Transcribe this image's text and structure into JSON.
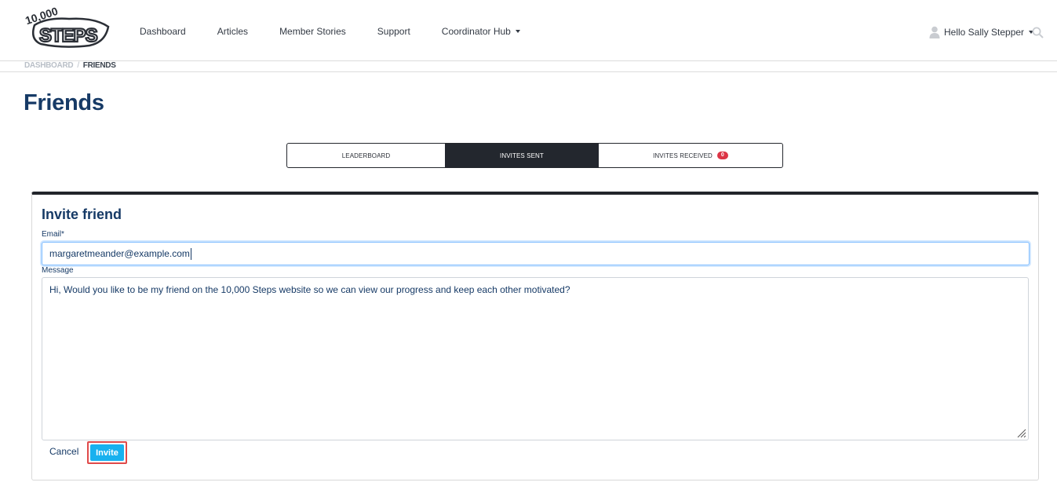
{
  "header": {
    "logo_text": "10,000 STEPS",
    "nav": [
      {
        "label": "Dashboard"
      },
      {
        "label": "Articles"
      },
      {
        "label": "Member Stories"
      },
      {
        "label": "Support"
      },
      {
        "label": "Coordinator Hub",
        "dropdown": true
      }
    ],
    "user_greeting": "Hello Sally Stepper"
  },
  "breadcrumb": {
    "items": [
      "DASHBOARD",
      "FRIENDS"
    ],
    "separator": "/"
  },
  "page": {
    "title": "Friends"
  },
  "tabs": [
    {
      "label": "LEADERBOARD",
      "active": false
    },
    {
      "label": "INVITES SENT",
      "active": true
    },
    {
      "label": "INVITES RECEIVED",
      "active": false,
      "badge": "0"
    }
  ],
  "invite_form": {
    "title": "Invite friend",
    "email_label": "Email*",
    "email_value": "margaretmeander@example.com",
    "message_label": "Message",
    "message_value": "Hi, Would you like to be my friend on the 10,000 Steps website so we can view our progress and keep each other motivated?",
    "cancel_label": "Cancel",
    "invite_label": "Invite"
  },
  "colors": {
    "title_blue": "#163a66",
    "active_tab": "#23272e",
    "badge_red": "#dc3545",
    "invite_button": "#18b1ef",
    "highlight_border": "#e04a4a"
  }
}
